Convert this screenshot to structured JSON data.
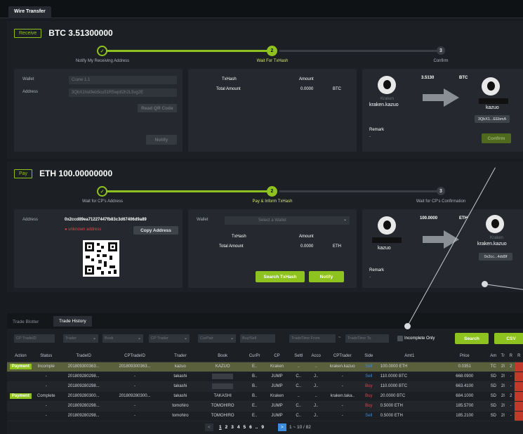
{
  "app": {
    "tab": "Wire Transfer"
  },
  "receive": {
    "tag": "Receive",
    "amount": "BTC 3.51300000",
    "steps": [
      "Notify My Receiving Address",
      "Wait For TxHash",
      "Confirm"
    ],
    "step3_num": "3",
    "step2_num": "2",
    "wallet_label": "Wallet",
    "wallet_value": "Crane 1.1",
    "address_label": "Address",
    "address_value": "3QbX1hst9eb5cu51R5wp82h2L5vg2E",
    "read_qr": "Read QR Code",
    "notify": "Notify",
    "txhash_header": "TxHash",
    "amount_header": "Amount",
    "total_amount": "Total Amount",
    "total_value": "0.0000",
    "total_unit": "BTC",
    "flow_amount": "3.5130",
    "flow_unit": "BTC",
    "from_exchange": "Kraken",
    "from_user": "kraken.kazuo",
    "to_user": "kazuo",
    "to_address": "3QbX1...EEbmA",
    "remark_label": "Remark",
    "remark_value": "-",
    "confirm": "Confirm"
  },
  "pay": {
    "tag": "Pay",
    "amount": "ETH 100.00000000",
    "steps": [
      "Wait for CP's Address",
      "Pay & Inform TxHash",
      "Wait for CP's Confirmation"
    ],
    "step2_num": "2",
    "step3_num": "3",
    "address_label": "Address",
    "address_value": "0x2ccd89ea71227447fb83c3d67406d9a89",
    "unknown": "unknown address",
    "copy_address": "Copy Address",
    "wallet_label": "Wallet",
    "wallet_placeholder": "Select a Wallet",
    "txhash_header": "TxHash",
    "amount_header": "Amount",
    "total_amount": "Total Amount",
    "total_value": "0.0000",
    "total_unit": "ETH",
    "search_txhash": "Search TxHash",
    "notify": "Notify",
    "flow_amount": "100.0000",
    "flow_unit": "ETH",
    "from_user": "kazuo",
    "to_exchange": "Kraken",
    "to_user": "kraken.kazuo",
    "to_address": "0x2cc...4dd9f",
    "remark_label": "Remark",
    "remark_value": "-"
  },
  "trades": {
    "tabs": [
      "Trade Blotter",
      "Trade History"
    ],
    "filters": [
      "CP TradeID",
      "Trader",
      "Book",
      "CP Trader",
      "CurPair",
      "Buy/Sell",
      "TradeTime From",
      "TradeTime To"
    ],
    "filter_sep": "~",
    "incomplete_only": "Incomplete Only",
    "search": "Search",
    "csv": "CSV",
    "columns": [
      "Action",
      "Status",
      "TradeID",
      "CPTradeID",
      "Trader",
      "Book",
      "CurPr",
      "CP",
      "Settl",
      "Acco",
      "CPTrader",
      "Side",
      "Amt1",
      "Price",
      "Am",
      "Tr",
      "R",
      "R"
    ],
    "rows": [
      {
        "action": "Payment",
        "status": "Incomple",
        "tradeid": "201809300363...",
        "cptradeid": "201809300363...",
        "trader": "kazuo",
        "book": "KAZUO",
        "cur": "E..",
        "cp": "Kraken",
        "settl": "..",
        "acco": "..",
        "cptrader": "kraken.kazuo",
        "side": "Sell",
        "amt": "100.0000",
        "amtcur": "ETH",
        "price": "0.0351",
        "am": "TC",
        "tr": "2I",
        "r": "2"
      },
      {
        "action": "",
        "status": "-",
        "tradeid": "201809280298...",
        "cptradeid": "-",
        "trader": "takashi",
        "book": "",
        "cur": "B..",
        "cp": "JUMP",
        "settl": "C..",
        "acco": "J..",
        "cptrader": "-",
        "side": "Sell",
        "amt": "110.0000",
        "amtcur": "BTC",
        "price": "668.0900",
        "am": "SD",
        "tr": "2I",
        "r": "-"
      },
      {
        "action": "",
        "status": "-",
        "tradeid": "201809280298...",
        "cptradeid": "-",
        "trader": "takashi",
        "book": "",
        "cur": "B..",
        "cp": "JUMP",
        "settl": "C..",
        "acco": "J..",
        "cptrader": "-",
        "side": "Buy",
        "amt": "110.0000",
        "amtcur": "BTC",
        "price": "663.4100",
        "am": "SD",
        "tr": "2I",
        "r": "-"
      },
      {
        "action": "Payment",
        "status": "Complete",
        "tradeid": "201809280300...",
        "cptradeid": "201809280300...",
        "trader": "takashi",
        "book": "TAKASHI",
        "cur": "B..",
        "cp": "Kraken",
        "settl": "..",
        "acco": "..",
        "cptrader": "kraken.taka..",
        "side": "Buy",
        "amt": "20.0000",
        "amtcur": "BTC",
        "price": "684.1000",
        "am": "SD",
        "tr": "2I",
        "r": "2"
      },
      {
        "action": "",
        "status": "-",
        "tradeid": "201809280298...",
        "cptradeid": "-",
        "trader": "tomohiro",
        "book": "TOMOHIRO",
        "cur": "E..",
        "cp": "JUMP",
        "settl": "C..",
        "acco": "J..",
        "cptrader": "-",
        "side": "Buy",
        "amt": "0.5000",
        "amtcur": "ETH",
        "price": "185.5700",
        "am": "SD",
        "tr": "2I",
        "r": "-"
      },
      {
        "action": "",
        "status": "-",
        "tradeid": "201809280298...",
        "cptradeid": "-",
        "trader": "tomohiro",
        "book": "TOMOHIRO",
        "cur": "E..",
        "cp": "JUMP",
        "settl": "C..",
        "acco": "J..",
        "cptrader": "-",
        "side": "Sell",
        "amt": "0.5000",
        "amtcur": "ETH",
        "price": "185.2100",
        "am": "SD",
        "tr": "2I",
        "r": "-"
      }
    ],
    "pager": {
      "prev": "<",
      "pages": [
        "1",
        "2",
        "3",
        "4",
        "5",
        "6",
        "..",
        "9"
      ],
      "next": ">",
      "range": "1 ~ 10 / 82"
    }
  },
  "colors": {
    "accent": "#8dc21f",
    "sell": "#3c8dde",
    "buy": "#d8474a",
    "highlight": "#5a5f3c"
  }
}
